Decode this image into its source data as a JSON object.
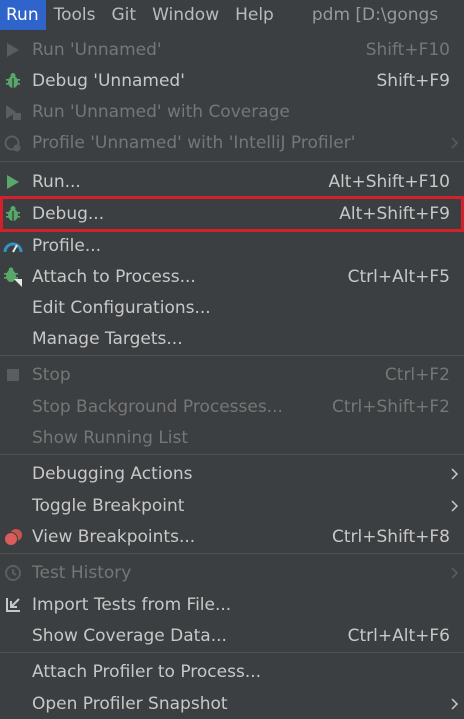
{
  "menubar": {
    "items": [
      {
        "label": "Run",
        "active": true
      },
      {
        "label": "Tools",
        "active": false
      },
      {
        "label": "Git",
        "active": false
      },
      {
        "label": "Window",
        "active": false
      },
      {
        "label": "Help",
        "active": false
      }
    ],
    "project_title": "pdm [D:\\gongs"
  },
  "menu": {
    "run_unnamed": {
      "label": "Run 'Unnamed'",
      "shortcut": "Shift+F10"
    },
    "debug_unnamed": {
      "label": "Debug 'Unnamed'",
      "shortcut": "Shift+F9"
    },
    "run_coverage": {
      "label": "Run 'Unnamed' with Coverage"
    },
    "profile_unnamed": {
      "label": "Profile 'Unnamed' with 'IntelliJ Profiler'"
    },
    "run": {
      "label": "Run...",
      "shortcut": "Alt+Shift+F10"
    },
    "debug": {
      "label": "Debug...",
      "shortcut": "Alt+Shift+F9"
    },
    "profile": {
      "label": "Profile..."
    },
    "attach": {
      "label": "Attach to Process...",
      "shortcut": "Ctrl+Alt+F5"
    },
    "edit_config": {
      "label": "Edit Configurations..."
    },
    "manage_targets": {
      "label": "Manage Targets..."
    },
    "stop": {
      "label": "Stop",
      "shortcut": "Ctrl+F2"
    },
    "stop_bg": {
      "label": "Stop Background Processes...",
      "shortcut": "Ctrl+Shift+F2"
    },
    "show_running": {
      "label": "Show Running List"
    },
    "debug_actions": {
      "label": "Debugging Actions"
    },
    "toggle_bp": {
      "label": "Toggle Breakpoint"
    },
    "view_bp": {
      "label": "View Breakpoints...",
      "shortcut": "Ctrl+Shift+F8"
    },
    "test_history": {
      "label": "Test History"
    },
    "import_tests": {
      "label": "Import Tests from File..."
    },
    "show_coverage": {
      "label": "Show Coverage Data...",
      "shortcut": "Ctrl+Alt+F6"
    },
    "attach_profiler": {
      "label": "Attach Profiler to Process..."
    },
    "open_snapshot": {
      "label": "Open Profiler Snapshot"
    }
  },
  "colors": {
    "background": "#3c3f41",
    "active_menu": "#2f65ca",
    "highlight_border": "#d3202a",
    "run_green": "#59a869",
    "breakpoint_red": "#c75450"
  }
}
